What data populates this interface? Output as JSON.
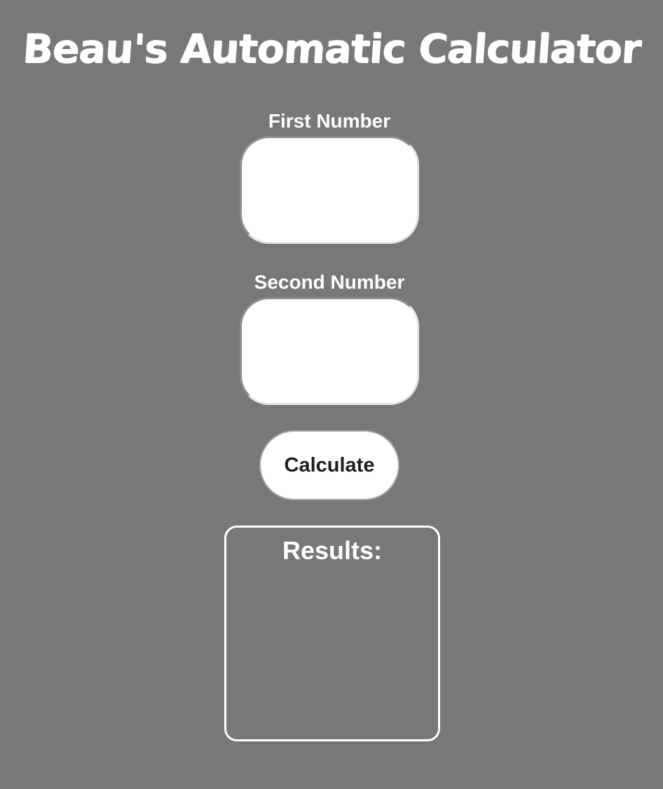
{
  "header": {
    "title": "Beau's Automatic Calculator"
  },
  "form": {
    "first_label": "First Number",
    "first_value": "",
    "second_label": "Second Number",
    "second_value": "",
    "calculate_label": "Calculate"
  },
  "results": {
    "heading": "Results:",
    "value": ""
  },
  "colors": {
    "background": "#787878",
    "text": "#ffffff",
    "input_background": "#ffffff",
    "button_text": "#1e1e1e"
  }
}
